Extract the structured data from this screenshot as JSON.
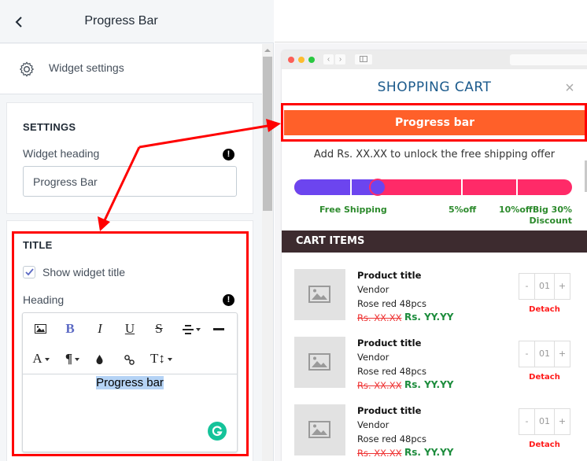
{
  "left_panel": {
    "header": {
      "back_icon": "chevron-left-icon",
      "title": "Progress Bar"
    },
    "widget_settings": {
      "icon": "gear-icon",
      "label": "Widget settings"
    },
    "settings_section": {
      "heading": "SETTINGS",
      "widget_heading_label": "Widget heading",
      "widget_heading_value": "Progress Bar",
      "info_icon": "!"
    },
    "title_section": {
      "heading": "TITLE",
      "show_title_label": "Show widget title",
      "show_title_checked": true,
      "heading_label": "Heading",
      "info_icon": "!",
      "toolbar": {
        "row1": [
          "image",
          "bold",
          "italic",
          "underline",
          "strikethrough",
          "align",
          "horizontal-rule"
        ],
        "row2": [
          "font-color",
          "paragraph",
          "background-color",
          "link",
          "font-size"
        ],
        "bold_glyph": "B",
        "italic_glyph": "I",
        "underline_glyph": "U",
        "strike_glyph": "S",
        "font_glyph": "A",
        "para_glyph": "¶",
        "size_glyph": "T↕"
      },
      "editor_content": "Progress bar"
    }
  },
  "preview": {
    "cart_title": "SHOPPING CART",
    "close_icon": "×",
    "progress_banner": "Progress bar",
    "offer_text": "Add Rs. XX.XX to unlock the free shipping offer",
    "progress": {
      "fraction": 0.3,
      "filled_color": "#6c45ef",
      "remaining_color": "#ff2a68",
      "milestones": [
        {
          "label": "Free Shipping",
          "position": 0.2
        },
        {
          "label": "5%off",
          "position": 0.6
        },
        {
          "label": "10%off",
          "position": 0.8
        },
        {
          "label": "Big 30% Discount",
          "position": 1.0
        }
      ],
      "label_free": "Free Shipping",
      "label_5": "5%off",
      "label_10_big_line1": "10%offBig 30%",
      "label_10_big_line2": "Discount"
    },
    "cart_items_heading": "CART ITEMS",
    "items": [
      {
        "title": "Product title",
        "vendor": "Vendor",
        "variant": "Rose red 48pcs",
        "old_price": "Rs. XX.XX",
        "new_price": "Rs. YY.YY",
        "qty": "01",
        "minus": "-",
        "plus": "+",
        "detach": "Detach"
      },
      {
        "title": "Product title",
        "vendor": "Vendor",
        "variant": "Rose red 48pcs",
        "old_price": "Rs. XX.XX",
        "new_price": "Rs. YY.YY",
        "qty": "01",
        "minus": "-",
        "plus": "+",
        "detach": "Detach"
      },
      {
        "title": "Product title",
        "vendor": "Vendor",
        "variant": "Rose red 48pcs",
        "old_price": "Rs. XX.XX",
        "new_price": "Rs. YY.YY",
        "qty": "01",
        "minus": "-",
        "plus": "+",
        "detach": "Detach"
      }
    ]
  },
  "colors": {
    "banner": "#ff6029",
    "annotation": "#ff0000",
    "cart_header_bg": "#3d2b2f",
    "milestone_text": "#2c8a2c",
    "detach": "#ff1a1a"
  }
}
